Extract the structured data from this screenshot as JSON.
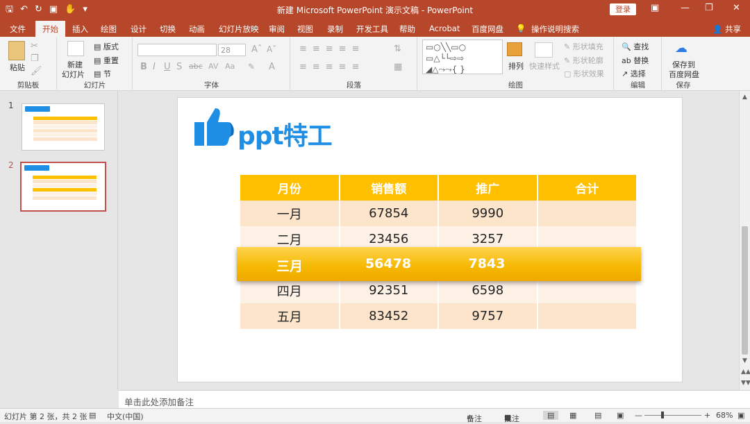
{
  "titlebar": {
    "title": "新建 Microsoft PowerPoint 演示文稿  -  PowerPoint",
    "login": "登录",
    "quick_access": [
      "save-icon",
      "undo-icon",
      "redo-icon",
      "present-icon",
      "touch-icon",
      "customize-icon"
    ]
  },
  "tabs": [
    "文件",
    "开始",
    "插入",
    "绘图",
    "设计",
    "切换",
    "动画",
    "幻灯片放映",
    "审阅",
    "视图",
    "录制",
    "开发工具",
    "帮助",
    "Acrobat",
    "百度网盘",
    "操作说明搜索"
  ],
  "active_tab": "开始",
  "share": "共享",
  "ribbon": {
    "clipboard": {
      "label": "剪贴板",
      "paste": "粘贴"
    },
    "slides": {
      "label": "幻灯片",
      "new_slide": "新建",
      "new_slide2": "幻灯片",
      "layout": "版式",
      "reset": "重置",
      "section": "节"
    },
    "font": {
      "label": "字体",
      "size": "28"
    },
    "paragraph": {
      "label": "段落"
    },
    "drawing": {
      "label": "绘图",
      "arrange": "排列",
      "quick_styles": "快速样式",
      "fill": "形状填充",
      "outline": "形状轮廓",
      "effects": "形状效果"
    },
    "editing": {
      "label": "编辑",
      "find": "查找",
      "replace": "替换",
      "select": "选择"
    },
    "save": {
      "label": "保存",
      "save_to": "保存到",
      "baidu": "百度网盘"
    }
  },
  "thumbnails": [
    {
      "num": "1"
    },
    {
      "num": "2"
    }
  ],
  "slide": {
    "logo_text": "ppt特工",
    "headers": [
      "月份",
      "销售额",
      "推广",
      "合计"
    ],
    "rows": [
      [
        "一月",
        "67854",
        "9990",
        ""
      ],
      [
        "二月",
        "23456",
        "3257",
        ""
      ],
      [
        "三月",
        "56478",
        "7843",
        ""
      ],
      [
        "四月",
        "92351",
        "6598",
        ""
      ],
      [
        "五月",
        "83452",
        "9757",
        ""
      ]
    ],
    "colors": {
      "header": "#ffc000",
      "row_dark": "#fde5cc",
      "row_light": "#fef1e6",
      "logo": "#1f8fe6"
    }
  },
  "notes_placeholder": "单击此处添加备注",
  "status": {
    "slide_info": "幻灯片 第 2 张，共 2 张",
    "language": "中文(中国)",
    "notes": "备注",
    "comments": "批注",
    "zoom": "68%"
  }
}
